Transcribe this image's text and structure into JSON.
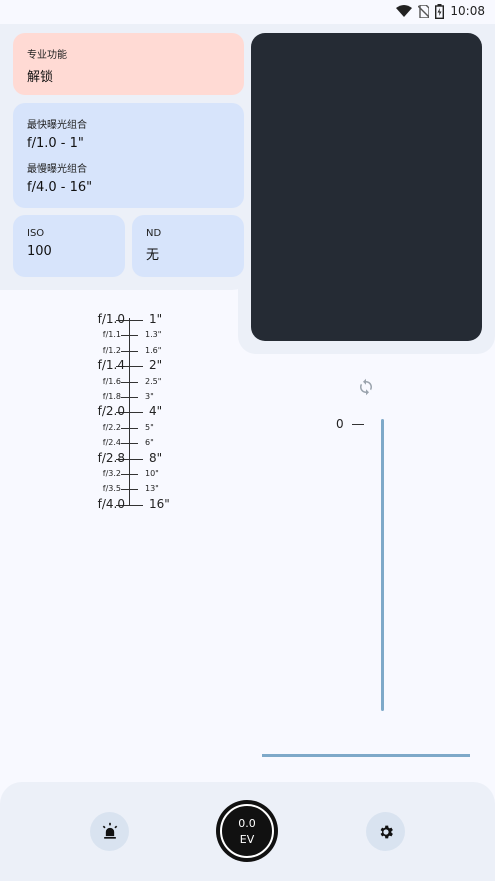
{
  "status_bar": {
    "time": "10:08",
    "icons": [
      "wifi-icon",
      "no-sim-icon",
      "battery-icon"
    ]
  },
  "cards": {
    "pro": {
      "label": "专业功能",
      "value": "解锁"
    },
    "combo": {
      "fastest_label": "最快曝光组合",
      "fastest_value": "f/1.0 - 1\"",
      "slowest_label": "最慢曝光组合",
      "slowest_value": "f/4.0 - 16\""
    },
    "iso": {
      "label": "ISO",
      "value": "100"
    },
    "nd": {
      "label": "ND",
      "value": "无"
    }
  },
  "scale": {
    "entries": [
      {
        "f": "f/1.0",
        "s": "1\"",
        "major": true
      },
      {
        "f": "f/1.1",
        "s": "1.3\"",
        "major": false
      },
      {
        "f": "f/1.2",
        "s": "1.6\"",
        "major": false
      },
      {
        "f": "f/1.4",
        "s": "2\"",
        "major": true
      },
      {
        "f": "f/1.6",
        "s": "2.5\"",
        "major": false
      },
      {
        "f": "f/1.8",
        "s": "3\"",
        "major": false
      },
      {
        "f": "f/2.0",
        "s": "4\"",
        "major": true
      },
      {
        "f": "f/2.2",
        "s": "5\"",
        "major": false
      },
      {
        "f": "f/2.4",
        "s": "6\"",
        "major": false
      },
      {
        "f": "f/2.8",
        "s": "8\"",
        "major": true
      },
      {
        "f": "f/3.2",
        "s": "10\"",
        "major": false
      },
      {
        "f": "f/3.5",
        "s": "13\"",
        "major": false
      },
      {
        "f": "f/4.0",
        "s": "16\"",
        "major": true
      }
    ]
  },
  "ev_slider": {
    "zero_label": "0"
  },
  "bottom": {
    "ev_value": "0.0",
    "ev_unit": "EV"
  },
  "colors": {
    "pro_card": "#ffdad4",
    "info_card": "#d7e4fb",
    "viewfinder": "#252b34",
    "track": "#7ea9c9"
  }
}
